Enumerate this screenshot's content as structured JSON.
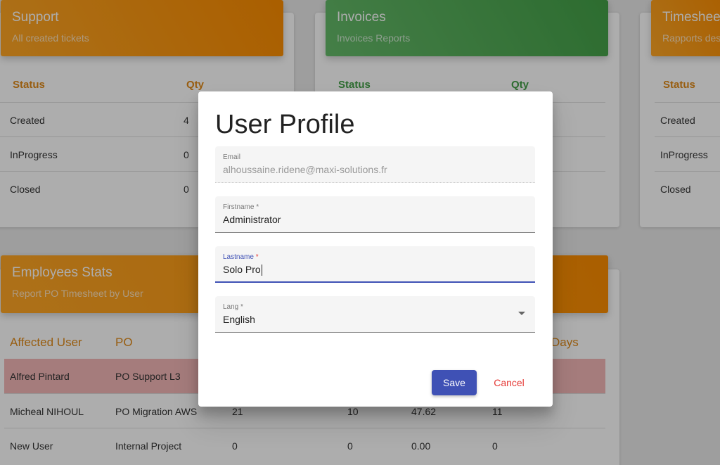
{
  "support": {
    "title": "Support",
    "subtitle": "All created tickets",
    "headers": [
      "Status",
      "Qty"
    ],
    "rows": [
      [
        "Created",
        "4"
      ],
      [
        "InProgress",
        "0"
      ],
      [
        "Closed",
        "0"
      ]
    ]
  },
  "invoices": {
    "title": "Invoices",
    "subtitle": "Invoices Reports",
    "headers": [
      "Status",
      "Qty"
    ]
  },
  "timesheet": {
    "title": "Timesheet",
    "subtitle": "Rapports des",
    "headers": [
      "Status"
    ],
    "rows": [
      [
        "Created"
      ],
      [
        "InProgress"
      ],
      [
        "Closed"
      ]
    ]
  },
  "employees": {
    "title": "Employees Stats",
    "subtitle": "Report PO Timesheet by User",
    "headers": [
      "Affected User",
      "PO",
      "Days"
    ],
    "rows": [
      [
        "Alfred Pintard",
        "PO Support L3",
        "",
        "",
        "",
        ""
      ],
      [
        "Micheal NIHOUL",
        "PO Migration AWS",
        "21",
        "10",
        "47.62",
        "11"
      ],
      [
        "New User",
        "Internal Project",
        "0",
        "0",
        "0.00",
        "0"
      ]
    ]
  },
  "dialog": {
    "title": "User Profile",
    "email": {
      "label": "Email",
      "value": "alhoussaine.ridene@maxi-solutions.fr"
    },
    "firstname": {
      "label": "Firstname",
      "required": "*",
      "value": "Administrator"
    },
    "lastname": {
      "label": "Lastname",
      "required": "*",
      "value": "Solo Pro"
    },
    "lang": {
      "label": "Lang",
      "required": "*",
      "value": "English"
    },
    "save_label": "Save",
    "cancel_label": "Cancel"
  }
}
